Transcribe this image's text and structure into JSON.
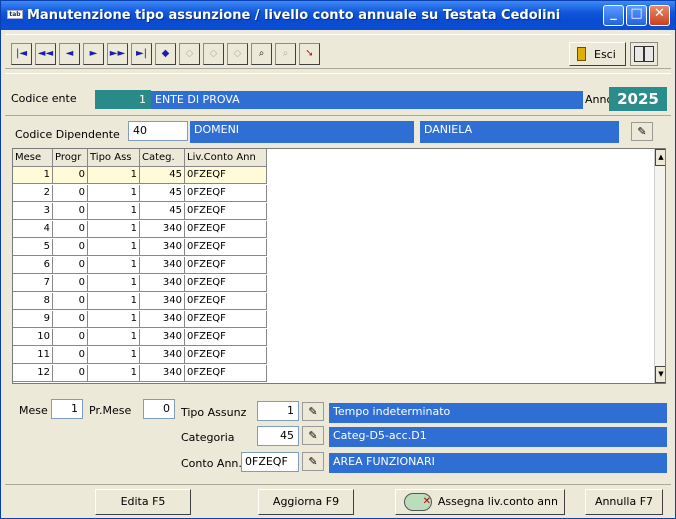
{
  "window": {
    "title": "Manutenzione tipo assunzione / livello conto annuale su Testata Cedolini",
    "app_icon_text": "tab"
  },
  "toolbar": {
    "nav": [
      "|◄",
      "◄◄",
      "◄",
      "►",
      "►►",
      "►|"
    ],
    "exit_label": "Esci"
  },
  "header": {
    "codice_ente_label": "Codice ente",
    "codice_ente_value": "1",
    "ente_name": "ENTE DI PROVA",
    "anno_label": "Anno",
    "anno_value": "2025",
    "codice_dip_label": "Codice Dipendente",
    "codice_dip_value": "40",
    "cognome": "DOMENI",
    "nome": "DANIELA"
  },
  "table": {
    "columns": [
      "Mese",
      "Progr",
      "Tipo Ass",
      "Categ.",
      "Liv.Conto Ann"
    ],
    "rows": [
      [
        "1",
        "0",
        "1",
        "45",
        "0FZEQF"
      ],
      [
        "2",
        "0",
        "1",
        "45",
        "0FZEQF"
      ],
      [
        "3",
        "0",
        "1",
        "45",
        "0FZEQF"
      ],
      [
        "4",
        "0",
        "1",
        "340",
        "0FZEQF"
      ],
      [
        "5",
        "0",
        "1",
        "340",
        "0FZEQF"
      ],
      [
        "6",
        "0",
        "1",
        "340",
        "0FZEQF"
      ],
      [
        "7",
        "0",
        "1",
        "340",
        "0FZEQF"
      ],
      [
        "8",
        "0",
        "1",
        "340",
        "0FZEQF"
      ],
      [
        "9",
        "0",
        "1",
        "340",
        "0FZEQF"
      ],
      [
        "10",
        "0",
        "1",
        "340",
        "0FZEQF"
      ],
      [
        "11",
        "0",
        "1",
        "340",
        "0FZEQF"
      ],
      [
        "12",
        "0",
        "1",
        "340",
        "0FZEQF"
      ]
    ]
  },
  "detail": {
    "mese_label": "Mese",
    "mese_value": "1",
    "prmese_label": "Pr.Mese",
    "prmese_value": "0",
    "tipo_label": "Tipo Assunz",
    "tipo_value": "1",
    "tipo_desc": "Tempo indeterminato",
    "categ_label": "Categoria",
    "categ_value": "45",
    "categ_desc": "Categ-D5-acc.D1",
    "conto_label": "Conto Ann.",
    "conto_value": "0FZEQF",
    "conto_desc": "AREA FUNZIONARI"
  },
  "buttons": {
    "edit": "Edita F5",
    "update": "Aggiorna F9",
    "assign": "Assegna liv.conto ann",
    "cancel": "Annulla F7"
  },
  "colors": {
    "accent_blue": "#2f6fd3",
    "teal": "#2a8c8c",
    "window_bg": "#ece9d8"
  }
}
